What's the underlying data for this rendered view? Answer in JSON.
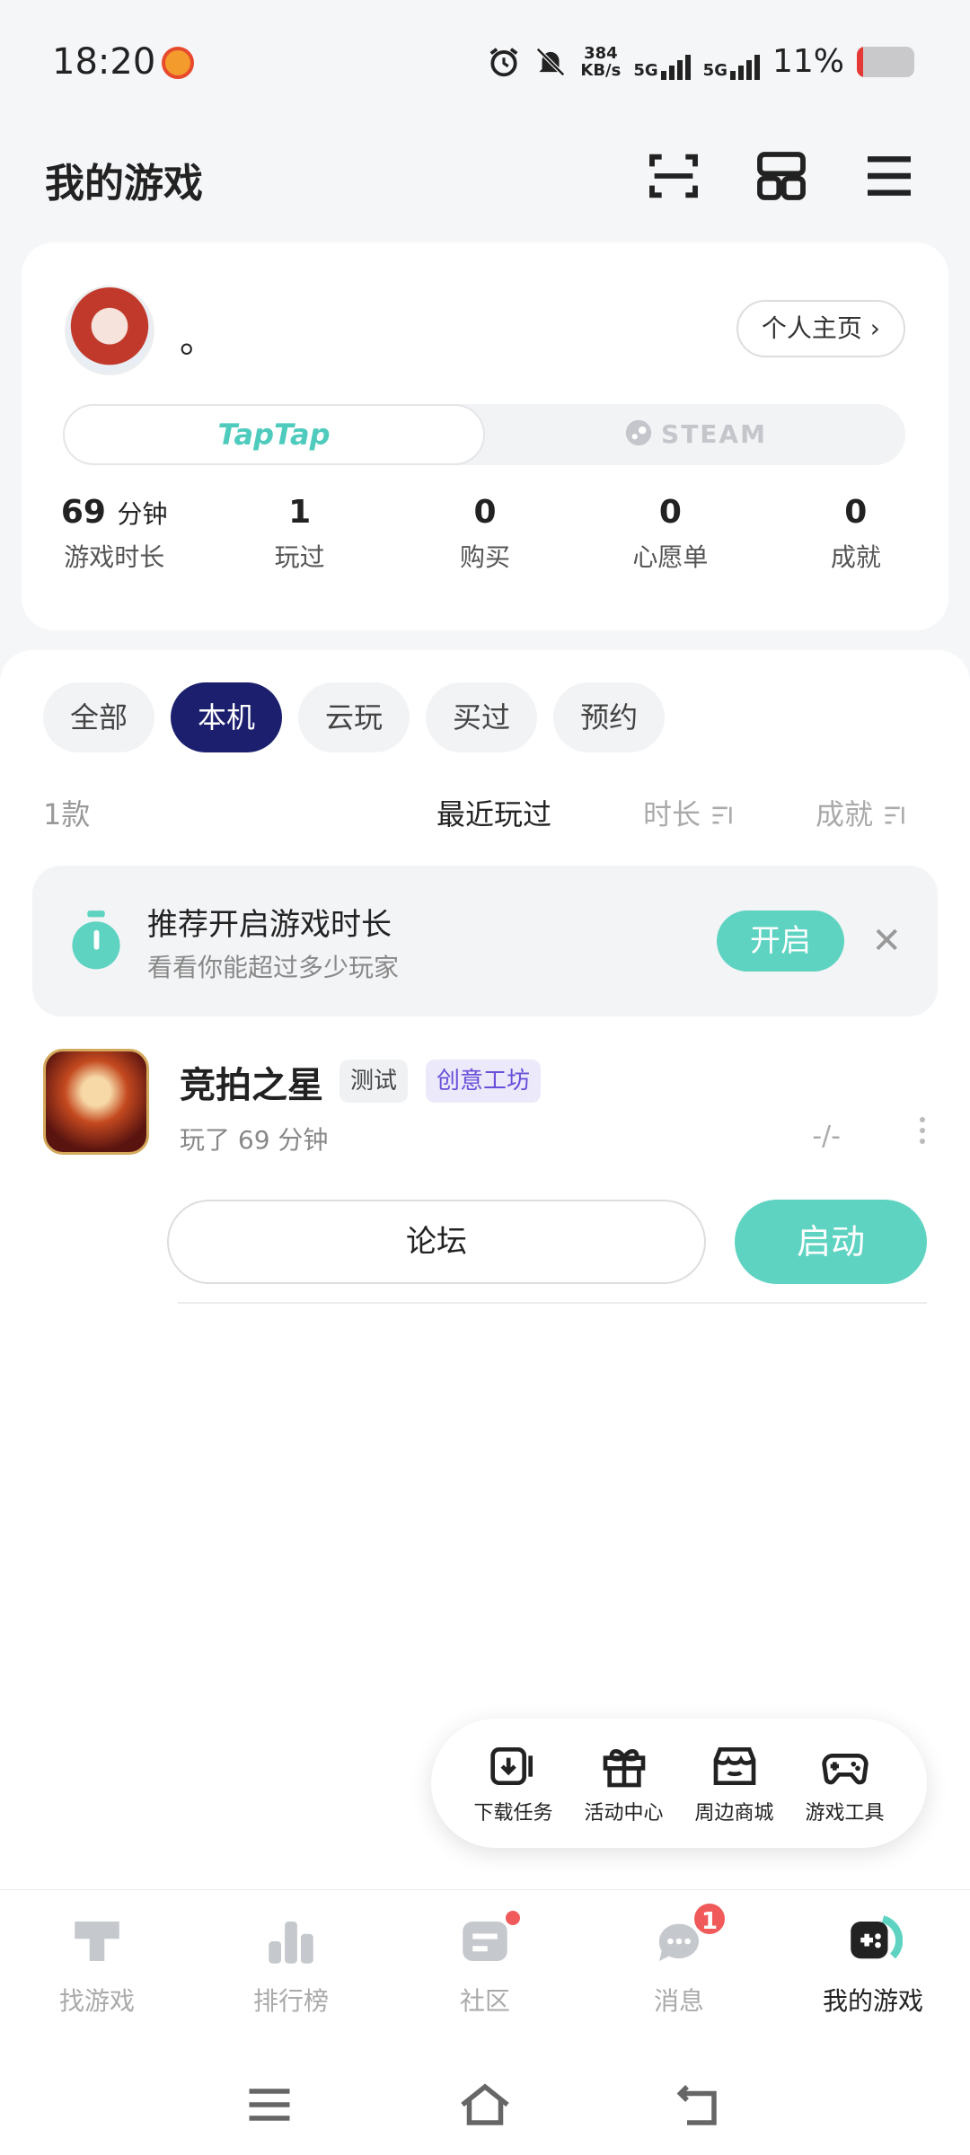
{
  "status_bar": {
    "time": "18:20",
    "speed_value": "384",
    "speed_unit": "KB/s",
    "signal_1": "5G",
    "signal_2": "5G",
    "battery": "11%"
  },
  "header": {
    "title": "我的游戏",
    "icons": [
      "scan-icon",
      "apps-grid-icon",
      "menu-icon"
    ]
  },
  "profile": {
    "username": "。",
    "home_button": "个人主页 ›",
    "platforms": {
      "taptap": "TapTap",
      "steam": "STEAM"
    },
    "stats": [
      {
        "value": "69",
        "unit": "分钟",
        "label": "游戏时长"
      },
      {
        "value": "1",
        "unit": "",
        "label": "玩过"
      },
      {
        "value": "0",
        "unit": "",
        "label": "购买"
      },
      {
        "value": "0",
        "unit": "",
        "label": "心愿单"
      },
      {
        "value": "0",
        "unit": "",
        "label": "成就"
      }
    ]
  },
  "filters": {
    "chips": [
      "全部",
      "本机",
      "云玩",
      "买过",
      "预约"
    ],
    "active": "本机"
  },
  "sort": {
    "count": "1款",
    "recent": "最近玩过",
    "duration": "时长",
    "achievement": "成就"
  },
  "recommend": {
    "title": "推荐开启游戏时长",
    "subtitle": "看看你能超过多少玩家",
    "button": "开启"
  },
  "game": {
    "name": "竞拍之星",
    "tag_test": "测试",
    "tag_workshop": "创意工坊",
    "played": "玩了 69 分钟",
    "rating": "-/-",
    "forum_button": "论坛",
    "launch_button": "启动"
  },
  "toolbox": {
    "items": [
      "下载任务",
      "活动中心",
      "周边商城",
      "游戏工具"
    ]
  },
  "bottom_nav": {
    "items": [
      "找游戏",
      "排行榜",
      "社区",
      "消息",
      "我的游戏"
    ],
    "active": "我的游戏",
    "message_badge": "1"
  },
  "colors": {
    "accent": "#5fd3c2",
    "active_chip": "#1c1f6e",
    "badge": "#f05a5a"
  }
}
